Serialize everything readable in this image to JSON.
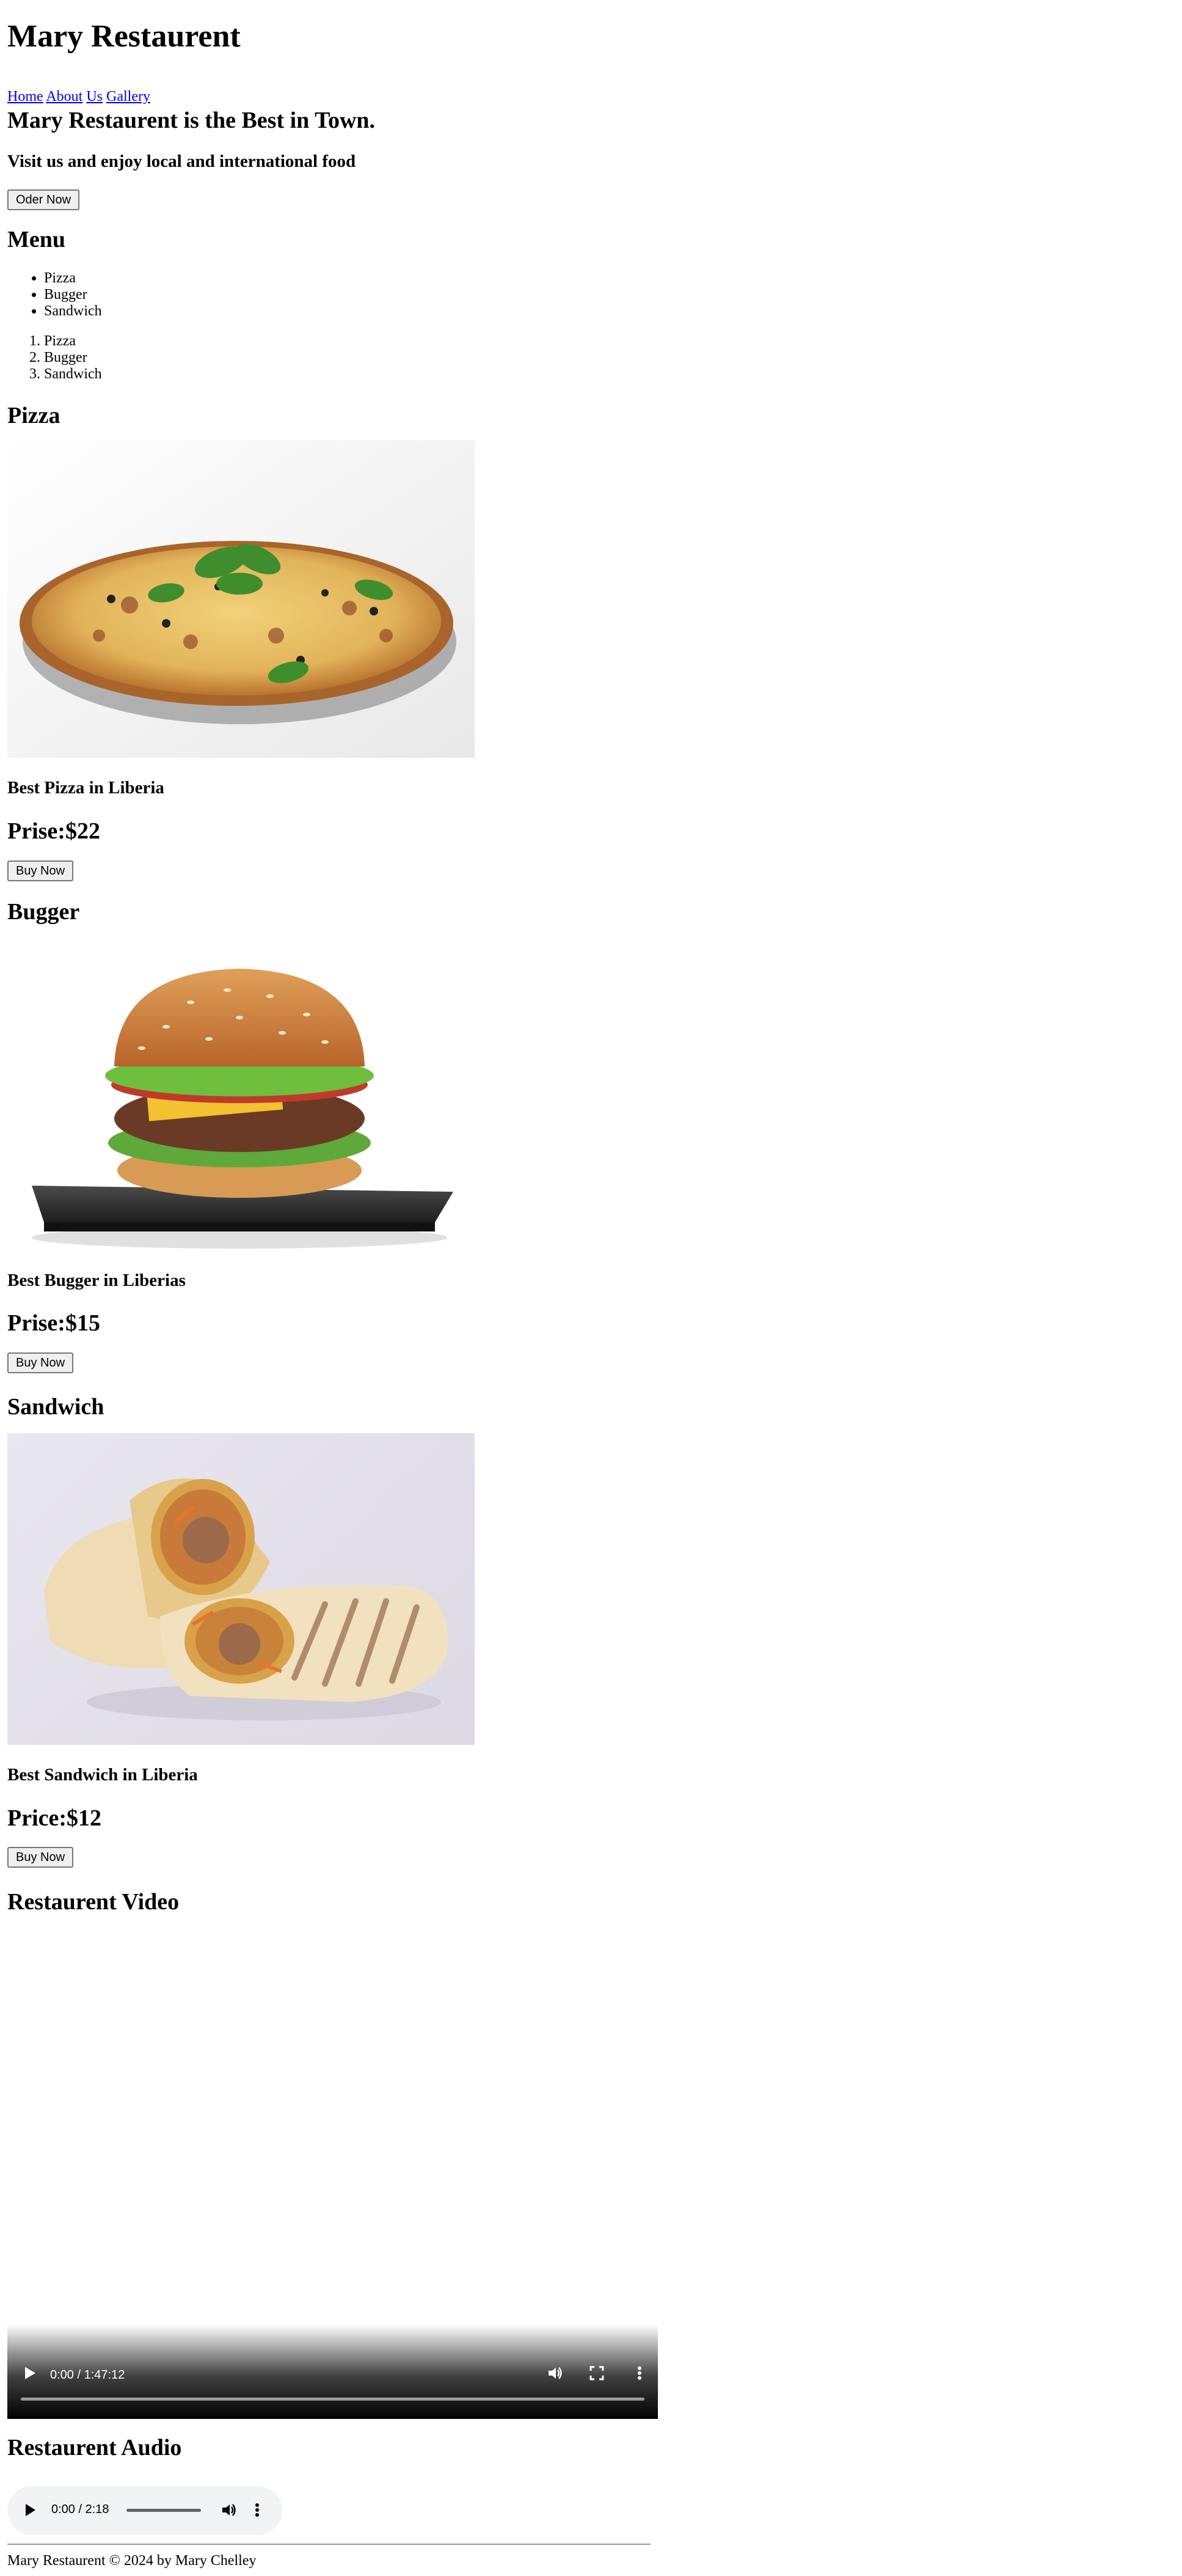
{
  "site": {
    "title": "Mary Restaurent",
    "nav": [
      {
        "label": "Home"
      },
      {
        "label": "About"
      },
      {
        "label": "Us"
      },
      {
        "label": "Gallery"
      }
    ]
  },
  "hero": {
    "headline": "Mary Restaurent is the Best in Town.",
    "subline": "Visit us and enjoy local and international food",
    "order_button": "Oder Now"
  },
  "menu": {
    "heading": "Menu",
    "unordered": [
      "Pizza",
      "Bugger",
      "Sandwich"
    ],
    "ordered": [
      "Pizza",
      "Bugger",
      "Sandwich"
    ]
  },
  "items": [
    {
      "heading": "Pizza",
      "tagline": "Best Pizza in Liberia",
      "price": "Prise:$22",
      "button": "Buy Now"
    },
    {
      "heading": "Bugger",
      "tagline": "Best Bugger in Liberias",
      "price": "Prise:$15",
      "button": "Buy Now"
    },
    {
      "heading": "Sandwich",
      "tagline": "Best Sandwich in Liberia",
      "price": "Price:$12",
      "button": "Buy Now"
    }
  ],
  "video": {
    "heading": "Restaurent Video",
    "time": "0:00 / 1:47:12",
    "progress": 0
  },
  "audio": {
    "heading": "Restaurent Audio",
    "time": "0:00 / 2:18",
    "progress": 0
  },
  "footer": {
    "text": "Mary Restaurent © 2024 by Mary Chelley"
  },
  "colors": {
    "link": "#0000ee",
    "button_bg": "#efefef",
    "audio_bg": "#f1f3f4"
  }
}
